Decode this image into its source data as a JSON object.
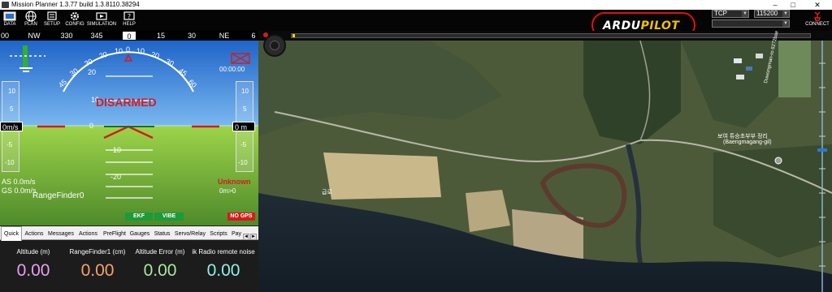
{
  "window": {
    "title": "Mission Planner 1.3.77 build 1.3.8110.38294",
    "minimize": "–",
    "maximize": "□",
    "close": "✕"
  },
  "toolbar": {
    "buttons": [
      {
        "label": "DATA",
        "icon": "data-icon"
      },
      {
        "label": "PLAN",
        "icon": "globe-icon"
      },
      {
        "label": "SETUP",
        "icon": "setup-icon"
      },
      {
        "label": "CONFIG",
        "icon": "gear-icon"
      },
      {
        "label": "SIMULATION",
        "icon": "simulation-icon"
      },
      {
        "label": "HELP",
        "icon": "help-icon"
      }
    ],
    "logo_part1": "ARDU",
    "logo_part2": "PILOT",
    "connection_type": "TCP",
    "baud_rate": "115200",
    "connect_label": "CONNECT"
  },
  "hud": {
    "compass": {
      "heading": "0",
      "labels": [
        "00",
        "NW",
        "330",
        "345",
        "15",
        "30",
        "NE",
        "6"
      ]
    },
    "pitch_scale": [
      "20",
      "10",
      "0",
      "-10",
      "-20"
    ],
    "roll_scale": [
      "30",
      "20",
      "10",
      "0",
      "10",
      "20",
      "30",
      "45",
      "60",
      "45",
      "60"
    ],
    "armed_status": "DISARMED",
    "speed_tape": [
      "10",
      "5",
      "-5",
      "-10"
    ],
    "speed_value": "0m/s",
    "alt_tape": [
      "10",
      "5",
      "-5",
      "-10"
    ],
    "alt_value": "0 m",
    "airspeed": "AS 0.0m/s",
    "groundspeed": "GS 0.0m/s",
    "rangefinder": "RangeFinder0",
    "mode": "Unknown",
    "distance": "0m>0",
    "flight_time": "00:00:00",
    "ekf": "EKF",
    "vibe": "VIBE",
    "gps": "NO GPS"
  },
  "tabs": [
    "Quick",
    "Actions",
    "Messages",
    "Actions",
    "PreFlight",
    "Gauges",
    "Status",
    "Servo/Relay",
    "Scripts",
    "Pay"
  ],
  "quick": [
    {
      "label": "Altitude (m)",
      "value": "0.00",
      "color": "#e8a0f0"
    },
    {
      "label": "RangeFinder1 (cm)",
      "value": "0.00",
      "color": "#f5a36a"
    },
    {
      "label": "Altitude Error (m)",
      "value": "0.00",
      "color": "#a8e8a0"
    },
    {
      "label": "ik Radio remote noise",
      "value": "0.00",
      "color": "#8ff0e8"
    }
  ],
  "map": {
    "place_label_1": "보여 튜승초부부 정리",
    "place_label_2": "(Baengmagang-gil)",
    "road_label": "Duwongman-ro 6272baegmagil",
    "small_label": "급로"
  },
  "colors": {
    "sky": "#2f7fd8",
    "ground": "#7fbf3a",
    "disarmed": "#d41c1c",
    "logo_border": "#e01010"
  }
}
